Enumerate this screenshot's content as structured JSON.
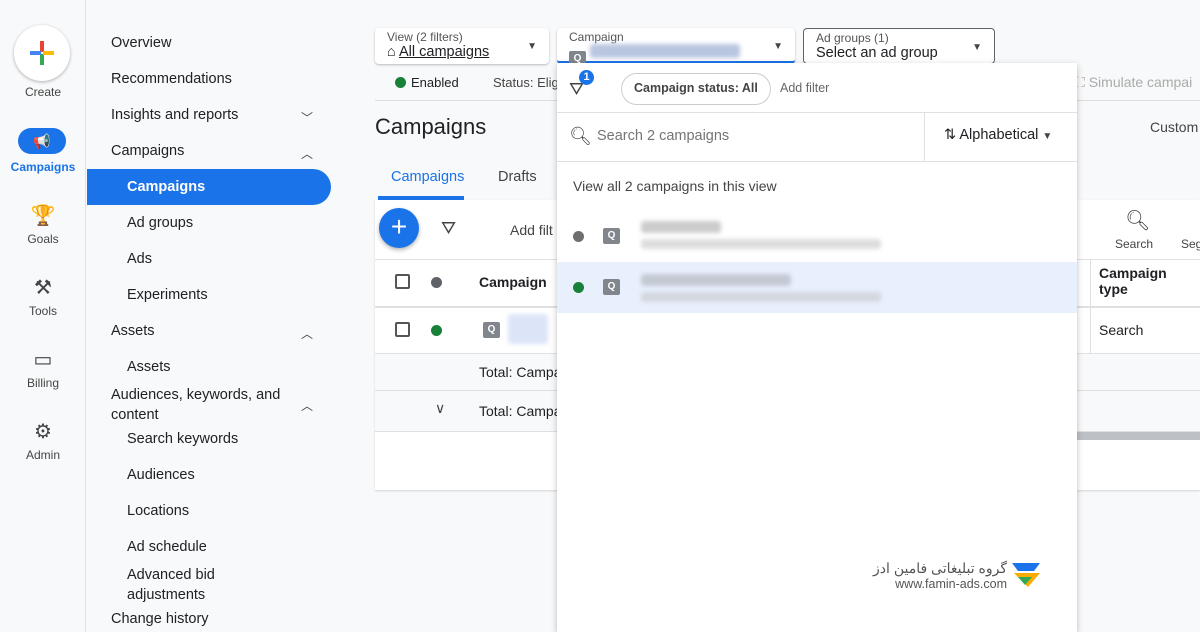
{
  "rail": {
    "create": "Create",
    "items": [
      {
        "label": "Campaigns",
        "icon": "megaphone-icon"
      },
      {
        "label": "Goals",
        "icon": "trophy-icon"
      },
      {
        "label": "Tools",
        "icon": "tools-icon"
      },
      {
        "label": "Billing",
        "icon": "credit-card-icon"
      },
      {
        "label": "Admin",
        "icon": "gear-icon"
      }
    ]
  },
  "nav": {
    "items": [
      "Overview",
      "Recommendations",
      "Insights and reports",
      "Campaigns",
      "Campaigns",
      "Ad groups",
      "Ads",
      "Experiments",
      "Assets",
      "Assets",
      "Audiences, keywords, and content",
      "Search keywords",
      "Audiences",
      "Locations",
      "Ad schedule",
      "Advanced bid adjustments",
      "Change history"
    ]
  },
  "top": {
    "view_label": "View (2 filters)",
    "view_value": "All campaigns",
    "campaign_label": "Campaign",
    "adgroups_label": "Ad groups (1)",
    "adgroups_value": "Select an ad group",
    "enabled": "Enabled",
    "status": "Status: Elig",
    "simulate": "Simulate campai",
    "custom": "Custom"
  },
  "page": {
    "title": "Campaigns",
    "tabs": [
      "Campaigns",
      "Drafts"
    ],
    "add_filter": "Add filt",
    "search": "Search",
    "segment": "Seg"
  },
  "table": {
    "col_campaign": "Campaign",
    "col_type": "Campaign type",
    "row_type": "Search",
    "total1": "Total: Campa",
    "total2": "Total: Campa"
  },
  "panel": {
    "filter_count": "1",
    "chip": "Campaign status: All",
    "add_filter": "Add filter",
    "search_placeholder": "Search 2 campaigns",
    "sort": "Alphabetical",
    "view_all": "View all 2 campaigns in this view"
  },
  "watermark": {
    "fa": "گروه تبلیغاتی فامین ادز",
    "url": "www.famin-ads.com"
  },
  "colors": {
    "accent": "#1a73e8",
    "enabled": "#188038",
    "selected_row": "#e8f0fe"
  }
}
